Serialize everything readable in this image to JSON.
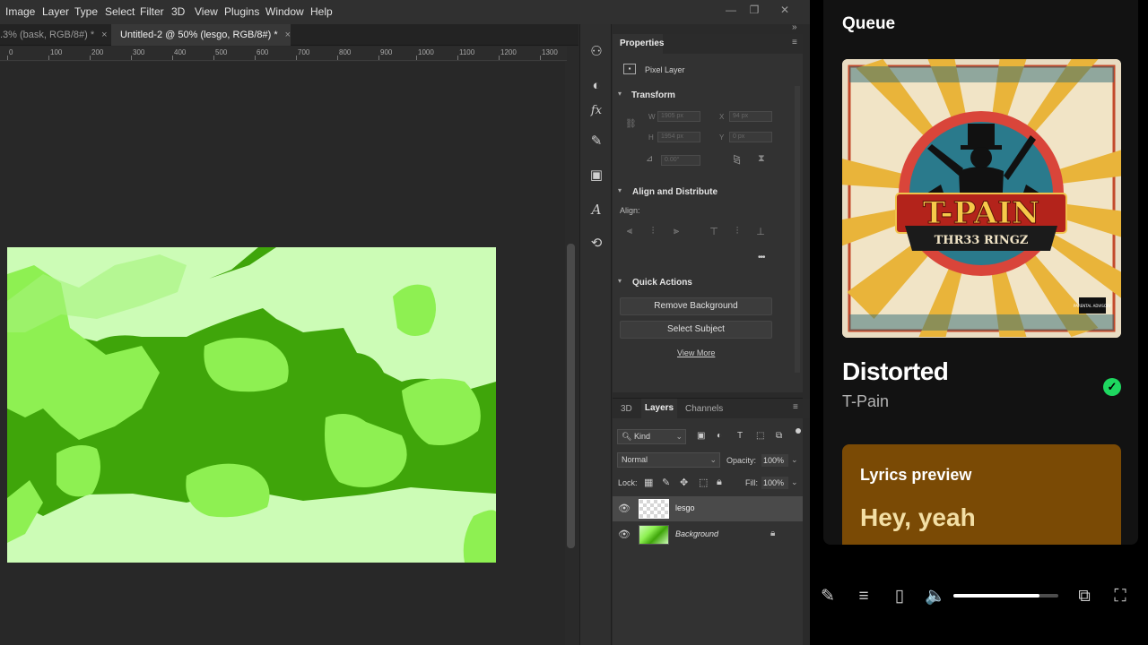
{
  "menu": [
    "Image",
    "Layer",
    "Type",
    "Select",
    "Filter",
    "3D",
    "View",
    "Plugins",
    "Window",
    "Help"
  ],
  "window_controls": {
    "minimize": "—",
    "restore": "❐",
    "close": "✕"
  },
  "tabs": [
    {
      "label": ".3% (bask, RGB/8#) *",
      "close": "×",
      "active": false
    },
    {
      "label": "Untitled-2 @ 50% (lesgo, RGB/8#) *",
      "close": "×",
      "active": true
    }
  ],
  "ruler_labels": [
    "0",
    "100",
    "200",
    "300",
    "400",
    "500",
    "600",
    "700",
    "800",
    "900",
    "1000",
    "1100",
    "1200",
    "1300"
  ],
  "properties": {
    "tab": "Properties",
    "layer_type": "Pixel Layer",
    "transform": {
      "title": "Transform",
      "w_label": "W",
      "w_value": "1905 px",
      "h_label": "H",
      "h_value": "1954 px",
      "x_label": "X",
      "x_value": "94 px",
      "y_label": "Y",
      "y_value": "0 px",
      "angle_value": "0.00°"
    },
    "align": {
      "title": "Align and Distribute",
      "label": "Align:",
      "more": "•••"
    },
    "quick_actions": {
      "title": "Quick Actions",
      "remove_bg": "Remove Background",
      "select_subject": "Select Subject",
      "view_more": "View More"
    }
  },
  "layers_panel": {
    "tabs": [
      "3D",
      "Layers",
      "Channels"
    ],
    "active_tab": "Layers",
    "filter_kind": "Kind",
    "blend_mode": "Normal",
    "opacity_label": "Opacity:",
    "opacity_value": "100%",
    "lock_label": "Lock:",
    "fill_label": "Fill:",
    "fill_value": "100%",
    "layers": [
      {
        "name": "lesgo",
        "selected": true
      },
      {
        "name": "Background",
        "locked": true
      }
    ]
  },
  "spotify": {
    "queue_title": "Queue",
    "album_art_text": {
      "artist": "T-PAIN",
      "album": "THR33 RINGZ",
      "advisory": "PARENTAL ADVISORY"
    },
    "song_title": "Distorted",
    "artist": "T-Pain",
    "saved_icon": "✓",
    "lyrics_title": "Lyrics preview",
    "lyrics_line": "Hey, yeah",
    "volume_fraction": 0.82,
    "colors": {
      "accent": "#1ed760",
      "lyrics_card": "#7a4a05"
    }
  },
  "icons": {
    "pen": "✎",
    "queue": "≡",
    "device": "▯",
    "volume": "🔈",
    "miniplayer": "⧉",
    "fullscreen": "⛶"
  }
}
